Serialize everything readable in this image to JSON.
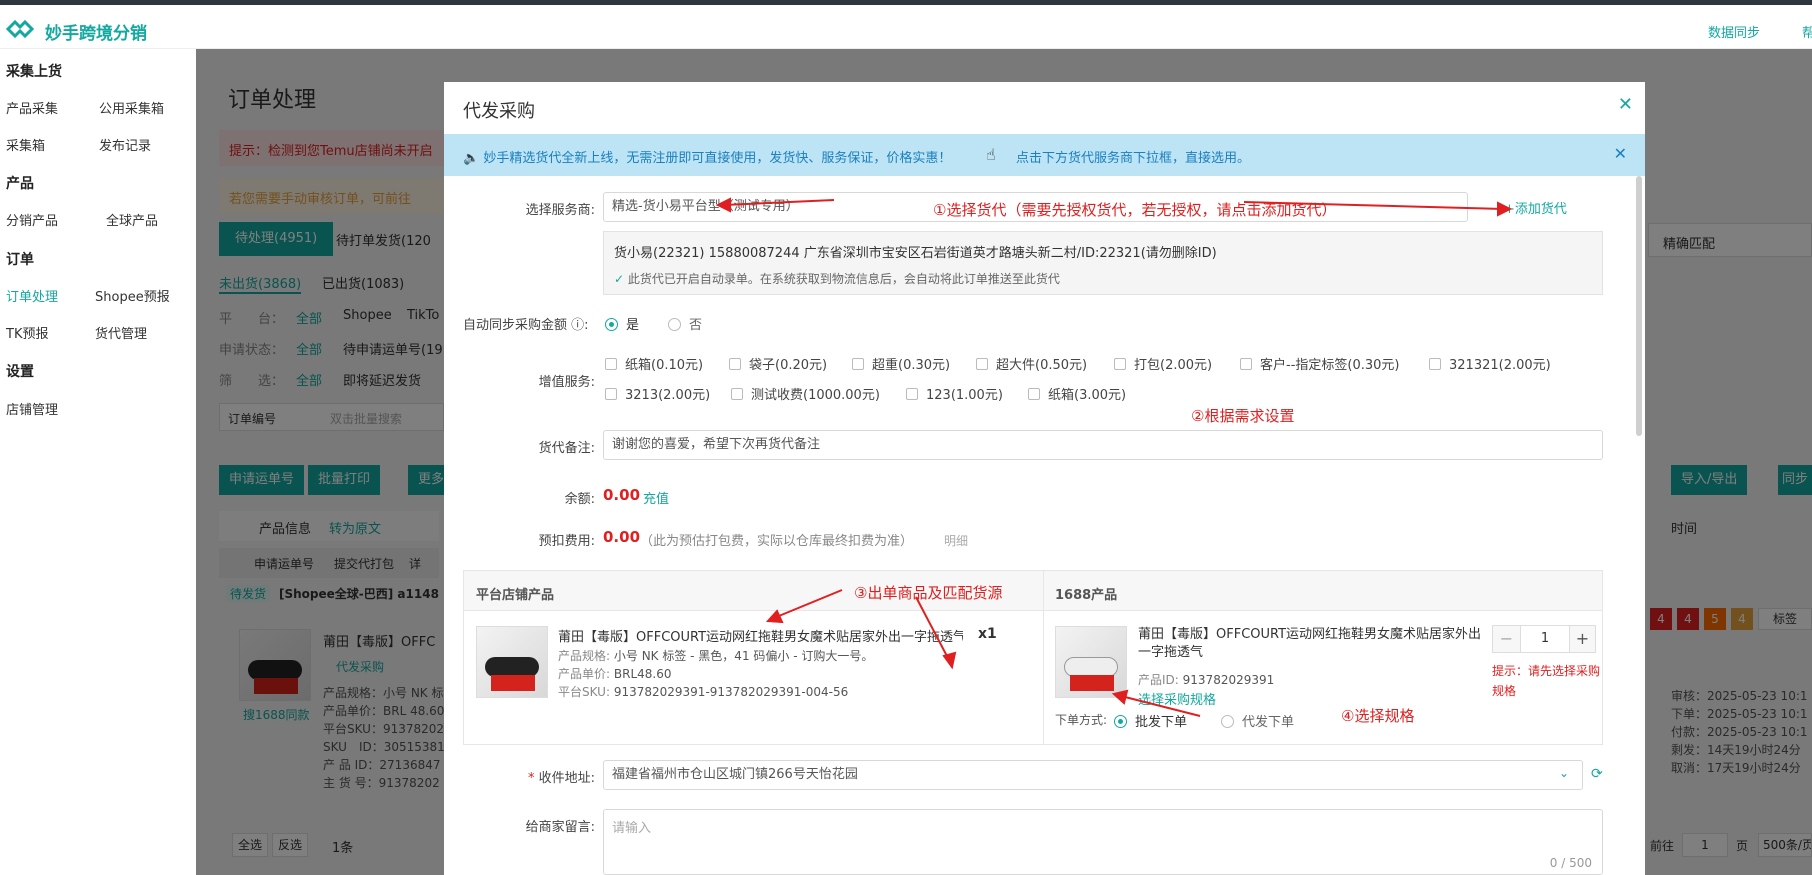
{
  "app": {
    "brand": "妙手跨境分销",
    "sync_link": "数据同步",
    "help_link": "帮"
  },
  "sidebar": {
    "sections": [
      {
        "title": "采集上货",
        "items": [
          "产品采集",
          "公用采集箱",
          "采集箱",
          "发布记录"
        ]
      },
      {
        "title": "产品",
        "items": [
          "分销产品",
          "全球产品"
        ]
      },
      {
        "title": "订单",
        "items": [
          "订单处理",
          "Shopee预报",
          "TK预报",
          "货代管理"
        ]
      },
      {
        "title": "设置",
        "items": [
          "店铺管理"
        ]
      }
    ],
    "active": "订单处理"
  },
  "background": {
    "page_title": "订单处理",
    "warning": "提示：检测到您Temu店铺尚未开启",
    "manual_note": "若您需要手动审核订单，可前往",
    "tab_pending": "待处理(4951)",
    "tab_waiting_print": "待打单发货(120",
    "tab_not_shipped": "未出货(3868)",
    "tab_shipped": "已出货(1083)",
    "platform_label": "平　　台：",
    "all": "全部",
    "platform_shopee": "Shopee",
    "platform_tiktok": "TikTo",
    "apply_status_label": "申请状态：",
    "apply_status_value": "待申请运单号(19",
    "filter_label": "筛　　选：",
    "filter_value": "即将延迟发货",
    "order_no_label": "订单编号",
    "batch_search": "双击批量搜索",
    "btn_apply_waybill": "申请运单号",
    "btn_batch_print": "批量打印",
    "btn_more": "更多",
    "col_product_info": "产品信息",
    "col_convert": "转为原文",
    "sub_apply": "申请运单号",
    "sub_submit": "提交代打包",
    "sub_detail": "详",
    "status_badge": "待发货",
    "shop_name": "[Shopee全球-巴西]  a1148",
    "product_title_bg": "莆田【毒版】OFFC",
    "proxy_purchase": "代发采购",
    "search_1688": "搜1688同款",
    "bg_spec": "产品规格：小号 NK 标",
    "bg_price": "产品单价：BRL 48.60",
    "bg_sku": "平台SKU：91378202",
    "bg_skuid": "SKU　ID：30515381",
    "bg_pid": "产 品 ID：27136847",
    "bg_main": "主 货 号：91378202",
    "select_all": "全选",
    "invert": "反选",
    "count": "1条",
    "right_exact": "精确匹配",
    "right_import": "导入/导出",
    "right_sync": "同步",
    "right_time": "时间",
    "badges": [
      "4",
      "4",
      "5",
      "4"
    ],
    "tag_btn": "标签",
    "review_time": "审核：2025-05-23 10:1",
    "order_time": "下单：2025-05-23 10:1",
    "pay_time": "付款：2025-05-23 10:1",
    "remain": "剩发：14天19小时24分",
    "cancel": "取消：17天19小时24分",
    "goto_page": "前往",
    "page_no": "1",
    "page_unit": "页",
    "page_size": "500条/页"
  },
  "modal": {
    "title": "代发采购",
    "notice": "妙手精选货代全新上线，无需注册即可直接使用，发货快、服务保证，价格实惠！",
    "notice_link": "点击下方货代服务商下拉框，直接选用。",
    "service_label": "选择服务商:",
    "service_value": "精选-货小易平台型（测试专用）",
    "add_forwarder": "+添加货代",
    "forwarder_info": "货小易(22321) 15880087244 广东省深圳市宝安区石岩街道英才路塘头新二村/ID:22321(请勿删除ID)",
    "forwarder_status": "此货代已开启自动录单。在系统获取到物流信息后，会自动将此订单推送至此货代",
    "sync_amount_label": "自动同步采购金额",
    "yes": "是",
    "no": "否",
    "vas_label": "增值服务:",
    "vas_options": [
      "纸箱(0.10元)",
      "袋子(0.20元)",
      "超重(0.30元)",
      "超大件(0.50元)",
      "打包(2.00元)",
      "客户--指定标签(0.30元)",
      "321321(2.00元)",
      "3213(2.00元)",
      "测试收费(1000.00元)",
      "123(1.00元)",
      "纸箱(3.00元)"
    ],
    "remark_label": "货代备注:",
    "remark_value": "谢谢您的喜爱，希望下次再货代备注",
    "balance_label": "余额:",
    "balance_value": "0.00",
    "recharge": "充值",
    "prepay_label": "预扣费用:",
    "prepay_value": "0.00",
    "prepay_note": "（此为预估打包费，实际以仓库最终扣费为准）",
    "detail_link": "明细",
    "platform_product_header": "平台店铺产品",
    "product_1688_header": "1688产品",
    "platform_product": {
      "title": "莆田【毒版】OFFCOURT运动网红拖鞋男女魔术贴居家外出一字拖透气",
      "qty": "x1",
      "spec_label": "产品规格:",
      "spec": "小号 NK 标签 - 黑色，41 码偏小 - 订购大一号。",
      "price_label": "产品单价:",
      "price": "BRL48.60",
      "sku_label": "平台SKU:",
      "sku": "913782029391-913782029391-004-56"
    },
    "product_1688": {
      "title": "莆田【毒版】OFFCOURT运动网红拖鞋男女魔术贴居家外出一字拖透气",
      "id_label": "产品ID:",
      "id": "913782029391",
      "select_spec": "选择采购规格",
      "order_mode_label": "下单方式:",
      "wholesale": "批发下单",
      "dropship": "代发下单",
      "quantity": "1",
      "warning": "提示：请先选择采购规格"
    },
    "address_label": "收件地址:",
    "address_value": "福建省福州市仓山区城门镇266号天怡花园",
    "message_label": "给商家留言:",
    "message_placeholder": "请输入",
    "char_count": "0 / 500"
  },
  "annotations": {
    "a1": "①选择货代（需要先授权货代，若无授权，请点击添加货代）",
    "a2": "②根据需求设置",
    "a3": "③出单商品及匹配货源",
    "a4": "④选择规格"
  },
  "colors": {
    "accent": "#13a8a0",
    "warning": "#e02020",
    "notice_bg": "#bde4f4",
    "notice_text": "#1b7fc0"
  }
}
